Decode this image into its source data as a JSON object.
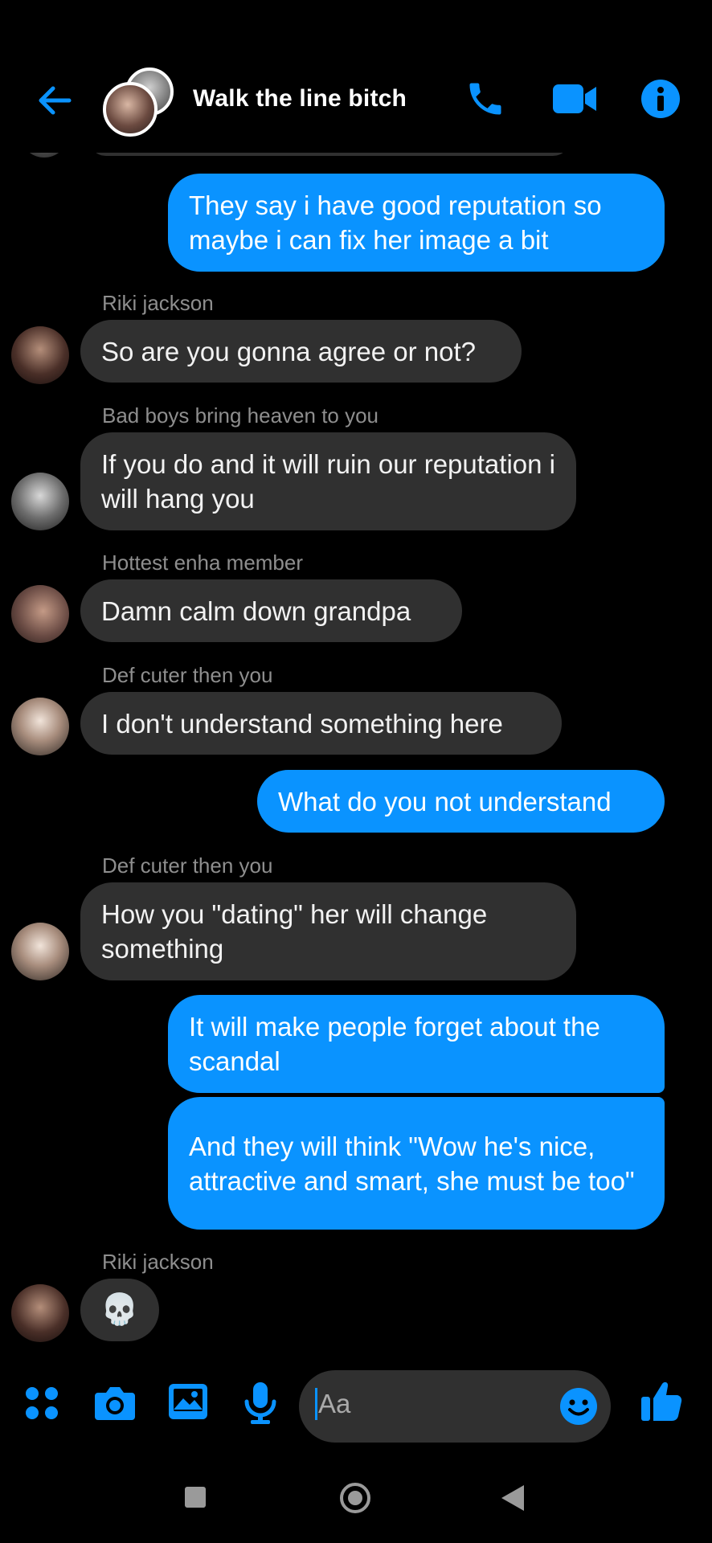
{
  "header": {
    "title": "Walk the line bitch",
    "back_icon": "back-arrow-icon",
    "call_icon": "phone-icon",
    "video_icon": "video-camera-icon",
    "info_icon": "info-icon"
  },
  "messages": [
    {
      "type": "outgoing",
      "text": "They say i have good reputation so maybe i can fix her image a bit"
    },
    {
      "type": "incoming",
      "sender": "Riki jackson",
      "text": "So are you gonna agree or not?"
    },
    {
      "type": "incoming",
      "sender": "Bad boys bring heaven to you",
      "text": "If you do and it will ruin our reputation i will hang you"
    },
    {
      "type": "incoming",
      "sender": "Hottest enha member",
      "text": "Damn calm down grandpa"
    },
    {
      "type": "incoming",
      "sender": "Def cuter then you",
      "text": "I don't understand something here"
    },
    {
      "type": "outgoing",
      "text": "What do you not understand"
    },
    {
      "type": "incoming",
      "sender": "Def cuter then you",
      "text": "How you \"dating\" her will change something"
    },
    {
      "type": "outgoing",
      "text": "It will make people forget about the scandal"
    },
    {
      "type": "outgoing",
      "text": "And they will think \"Wow he's nice, attractive and smart, she must be too\""
    },
    {
      "type": "incoming",
      "sender": "Riki jackson",
      "text": "💀"
    }
  ],
  "composer": {
    "placeholder": "Aa",
    "icons": [
      "apps-icon",
      "camera-icon",
      "image-icon",
      "microphone-icon",
      "emoji-icon",
      "thumbs-up-icon"
    ]
  },
  "colors": {
    "accent": "#0a93ff",
    "incoming_bubble": "#303030",
    "background": "#000000"
  }
}
